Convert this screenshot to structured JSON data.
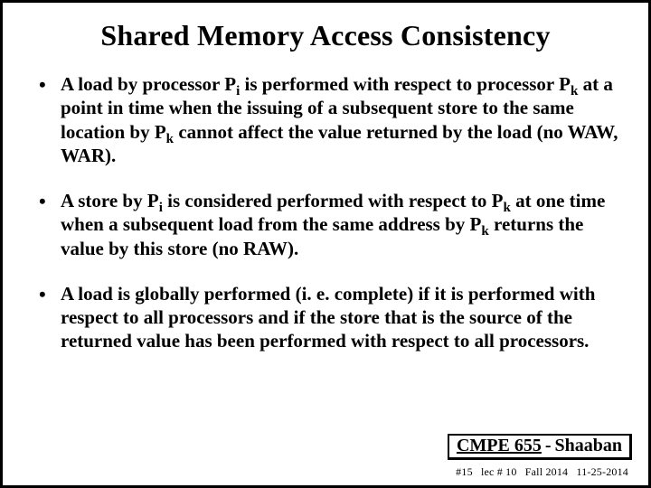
{
  "title": "Shared Memory Access Consistency",
  "bullets": [
    {
      "html": "A load by processor P<span class=\"sub\">i</span>  is performed with respect to processor P<span class=\"sub\">k</span> at a point in time when the issuing of a subsequent store to the same location by P<span class=\"sub\">k</span> cannot affect the value returned by the load  (no WAW, WAR)."
    },
    {
      "html": "A store by P<span class=\"sub\">i</span> is considered performed with respect to P<span class=\"sub\">k</span> at one time when a subsequent load from  the same address by P<span class=\"sub\">k</span> returns the value by this store (no RAW)."
    },
    {
      "html": "A load is globally performed (i. e. complete) if it is performed with respect to all processors and if the store that is the source of the returned value has been performed with respect to all processors."
    }
  ],
  "footer": {
    "course": "CMPE 655",
    "dash": "-",
    "author": "Shaaban"
  },
  "meta": {
    "slide_no": "#15",
    "lec": "lec # 10",
    "term": "Fall 2014",
    "date": "11-25-2014"
  }
}
